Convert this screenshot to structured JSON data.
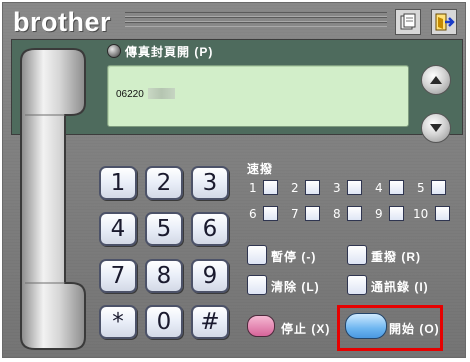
{
  "app": {
    "brand": "brother"
  },
  "toolbar": {
    "icons": [
      "address-book-icon",
      "exit-icon"
    ]
  },
  "cover_page": {
    "label": "傳真封頁開 (P)"
  },
  "lcd": {
    "number": "06220"
  },
  "keypad": {
    "keys": [
      "1",
      "2",
      "3",
      "4",
      "5",
      "6",
      "7",
      "8",
      "9",
      "*",
      "0",
      "#"
    ]
  },
  "speed_dial": {
    "label": "速撥",
    "slots": [
      "1",
      "2",
      "3",
      "4",
      "5",
      "6",
      "7",
      "8",
      "9",
      "10"
    ]
  },
  "functions": {
    "pause": "暫停 (-)",
    "redial": "重撥 (R)",
    "clear": "清除 (L)",
    "address_book": "通訊錄 (I)",
    "stop": "停止 (X)",
    "start": "開始 (O)"
  },
  "colors": {
    "body": "#7c7c7c",
    "lcd": "#d2eec9",
    "panel": "#4e6b5d",
    "stop": "#d7659a",
    "start": "#6eb6f0",
    "highlight": "#e60000"
  }
}
